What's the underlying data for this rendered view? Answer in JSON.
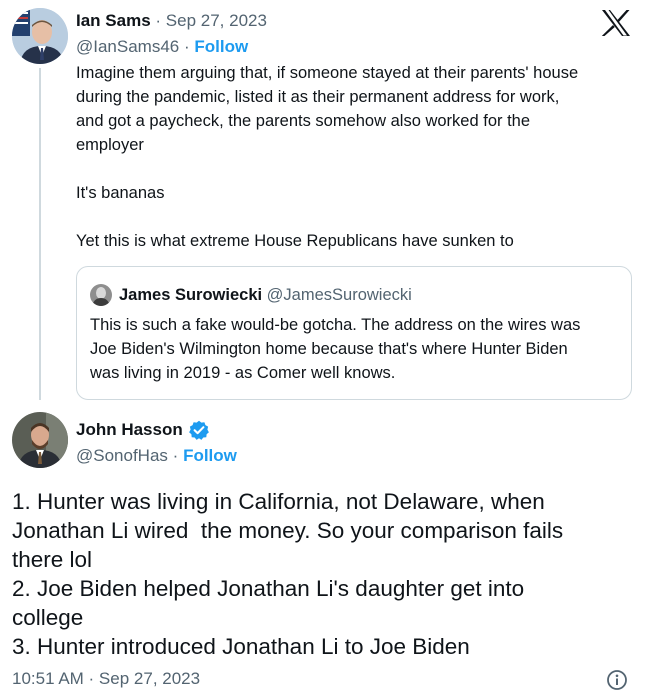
{
  "tweet1": {
    "author_name": "Ian Sams",
    "separator": "·",
    "date": "Sep 27, 2023",
    "handle": "@IanSams46",
    "follow_separator": "·",
    "follow_label": "Follow",
    "text": "Imagine them arguing that, if someone stayed at their parents' house\nduring the pandemic, listed it as their permanent address for work,\nand got a paycheck, the parents somehow also worked for the\nemployer\n\nIt's bananas\n\nYet this is what extreme House Republicans have sunken to"
  },
  "quote": {
    "author_name": "James Surowiecki",
    "handle": "@JamesSurowiecki",
    "text": "This is such a fake would-be gotcha. The address on the wires was\nJoe Biden's Wilmington home because that's where Hunter Biden\nwas living in 2019 - as Comer well knows."
  },
  "tweet2": {
    "author_name": "John Hasson",
    "handle": "@SonofHas",
    "follow_separator": "·",
    "follow_label": "Follow",
    "text": "1. Hunter was living in California, not Delaware, when\nJonathan Li wired  the money. So your comparison fails\nthere lol\n2. Joe Biden helped Jonathan Li's daughter get into\ncollege\n3. Hunter introduced Jonathan Li to Joe Biden",
    "timestamp": "10:51 AM · Sep 27, 2023"
  },
  "icons": {
    "logo": "x-logo-icon",
    "verified": "verified-badge-icon",
    "info": "info-icon"
  },
  "colors": {
    "link": "#1d9bf0",
    "muted": "#536471",
    "text": "#0f1419",
    "border": "#cfd9de"
  }
}
